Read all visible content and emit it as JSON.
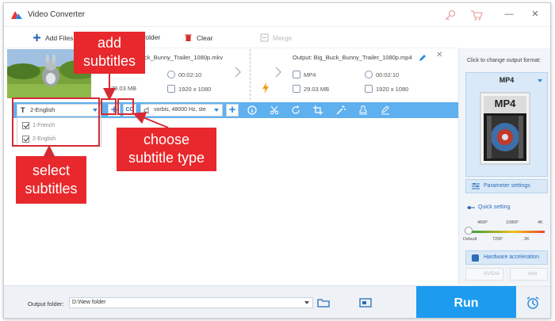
{
  "app": {
    "title": "Video Converter",
    "window_controls": [
      "—",
      "✕"
    ]
  },
  "toolbar": {
    "add_files": "Add Files",
    "add_folder": "folder",
    "clear": "Clear",
    "merge": "Merge"
  },
  "item": {
    "source": {
      "filename": "ck_Bunny_Trailer_1080p.mkv",
      "duration": "00:02:10",
      "size": "29.03 MB",
      "resolution": "1920 x 1080"
    },
    "output": {
      "filename": "Output: Big_Buck_Bunny_Trailer_1080p.mp4",
      "format": "MP4",
      "duration": "00:02:10",
      "size": "29.03 MB",
      "resolution": "1920 x 1080"
    }
  },
  "edit_bar": {
    "subtitle_selected": "2-English",
    "subtitle_icon": "T",
    "cc_label": "CC",
    "audio_track": "vorbis, 48000 Hz, ste",
    "subtitle_options": [
      {
        "label": "1-French",
        "checked": true
      },
      {
        "label": "2-English",
        "checked": true
      }
    ]
  },
  "annotations": {
    "add_subtitles": [
      "add",
      "subtitles"
    ],
    "choose_subtitle_type": [
      "choose",
      "subtitle type"
    ],
    "select_subtitles": [
      "select",
      "subtitles"
    ]
  },
  "right_panel": {
    "title": "Click to change output format:",
    "format": "MP4",
    "format_icon_text": "MP4",
    "parameter_settings": "Parameter settings",
    "quick_setting": "Quick setting",
    "quality_ticks_top": [
      "480P",
      "1080P",
      "4K"
    ],
    "quality_ticks_bottom": [
      "Default",
      "720P",
      "2K"
    ],
    "quality_level": 0,
    "hardware_acceleration": "Hardware acceleration",
    "nvidia": "NVIDIA",
    "intel": "Intel"
  },
  "bottom": {
    "output_folder_label": "Output folder:",
    "output_folder_value": "D:\\New folder",
    "run_label": "Run"
  },
  "colors": {
    "accent": "#1d9bef",
    "strip": "#5fb0ee",
    "callout": "#e8282c"
  }
}
